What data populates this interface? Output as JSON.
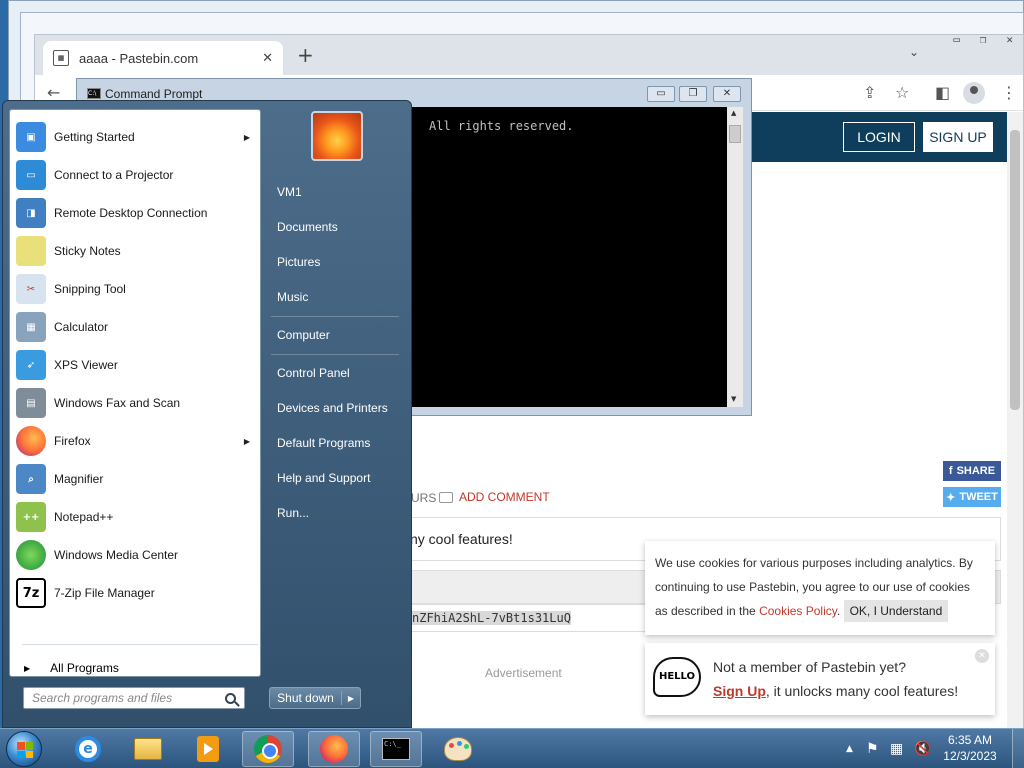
{
  "browser": {
    "tab_title": "aaaa - Pastebin.com",
    "tab_favicon": "pastebin-icon",
    "new_tab": "+",
    "close_tab": "✕"
  },
  "pastebin": {
    "login": "LOGIN",
    "signup": "SIGN UP",
    "hours_fragment": "URS",
    "add_comment": "ADD COMMENT",
    "share": "SHARE",
    "tweet": "TWEET",
    "paste_text": "ny cool features!",
    "paste_url": "nZFhiA2ShL-7vBt1s31LuQ",
    "advertisement": "Advertisement",
    "cookie_text_1": "We use cookies for various purposes including analytics. By continuing to use Pastebin, you agree to our use of cookies as described in the ",
    "cookie_link": "Cookies Policy",
    "cookie_text_2": ".",
    "cookie_button": "OK, I Understand",
    "member_line1": "Not a member of Pastebin yet?",
    "member_signup": "Sign Up",
    "member_line2": ", it unlocks many cool features!",
    "hello_badge": "HELLO"
  },
  "cmd": {
    "title": "Command Prompt",
    "output": "All rights reserved.",
    "minimize": "▭",
    "restore": "❐",
    "close": "✕"
  },
  "start_menu": {
    "programs": [
      {
        "label": "Getting Started",
        "icon": "getting-started-icon",
        "submenu": true
      },
      {
        "label": "Connect to a Projector",
        "icon": "projector-icon",
        "submenu": false
      },
      {
        "label": "Remote Desktop Connection",
        "icon": "remote-desktop-icon",
        "submenu": false
      },
      {
        "label": "Sticky Notes",
        "icon": "sticky-notes-icon",
        "submenu": false
      },
      {
        "label": "Snipping Tool",
        "icon": "snipping-tool-icon",
        "submenu": false
      },
      {
        "label": "Calculator",
        "icon": "calculator-icon",
        "submenu": false
      },
      {
        "label": "XPS Viewer",
        "icon": "xps-viewer-icon",
        "submenu": false
      },
      {
        "label": "Windows Fax and Scan",
        "icon": "fax-scan-icon",
        "submenu": false
      },
      {
        "label": "Firefox",
        "icon": "firefox-icon",
        "submenu": true
      },
      {
        "label": "Magnifier",
        "icon": "magnifier-icon",
        "submenu": false
      },
      {
        "label": "Notepad++",
        "icon": "notepadpp-icon",
        "submenu": false
      },
      {
        "label": "Windows Media Center",
        "icon": "media-center-icon",
        "submenu": false
      },
      {
        "label": "7-Zip File Manager",
        "icon": "7zip-icon",
        "submenu": false
      }
    ],
    "all_programs": "All Programs",
    "search_placeholder": "Search programs and files",
    "right_items": [
      "VM1",
      "Documents",
      "Pictures",
      "Music",
      "Computer",
      "Control Panel",
      "Devices and Printers",
      "Default Programs",
      "Help and Support",
      "Run..."
    ],
    "shutdown": "Shut down"
  },
  "taskbar": {
    "time": "6:35 AM",
    "date": "12/3/2023",
    "apps": [
      "internet-explorer-icon",
      "file-explorer-icon",
      "media-player-icon",
      "chrome-icon",
      "firefox-icon",
      "command-prompt-icon",
      "paint-icon"
    ]
  }
}
